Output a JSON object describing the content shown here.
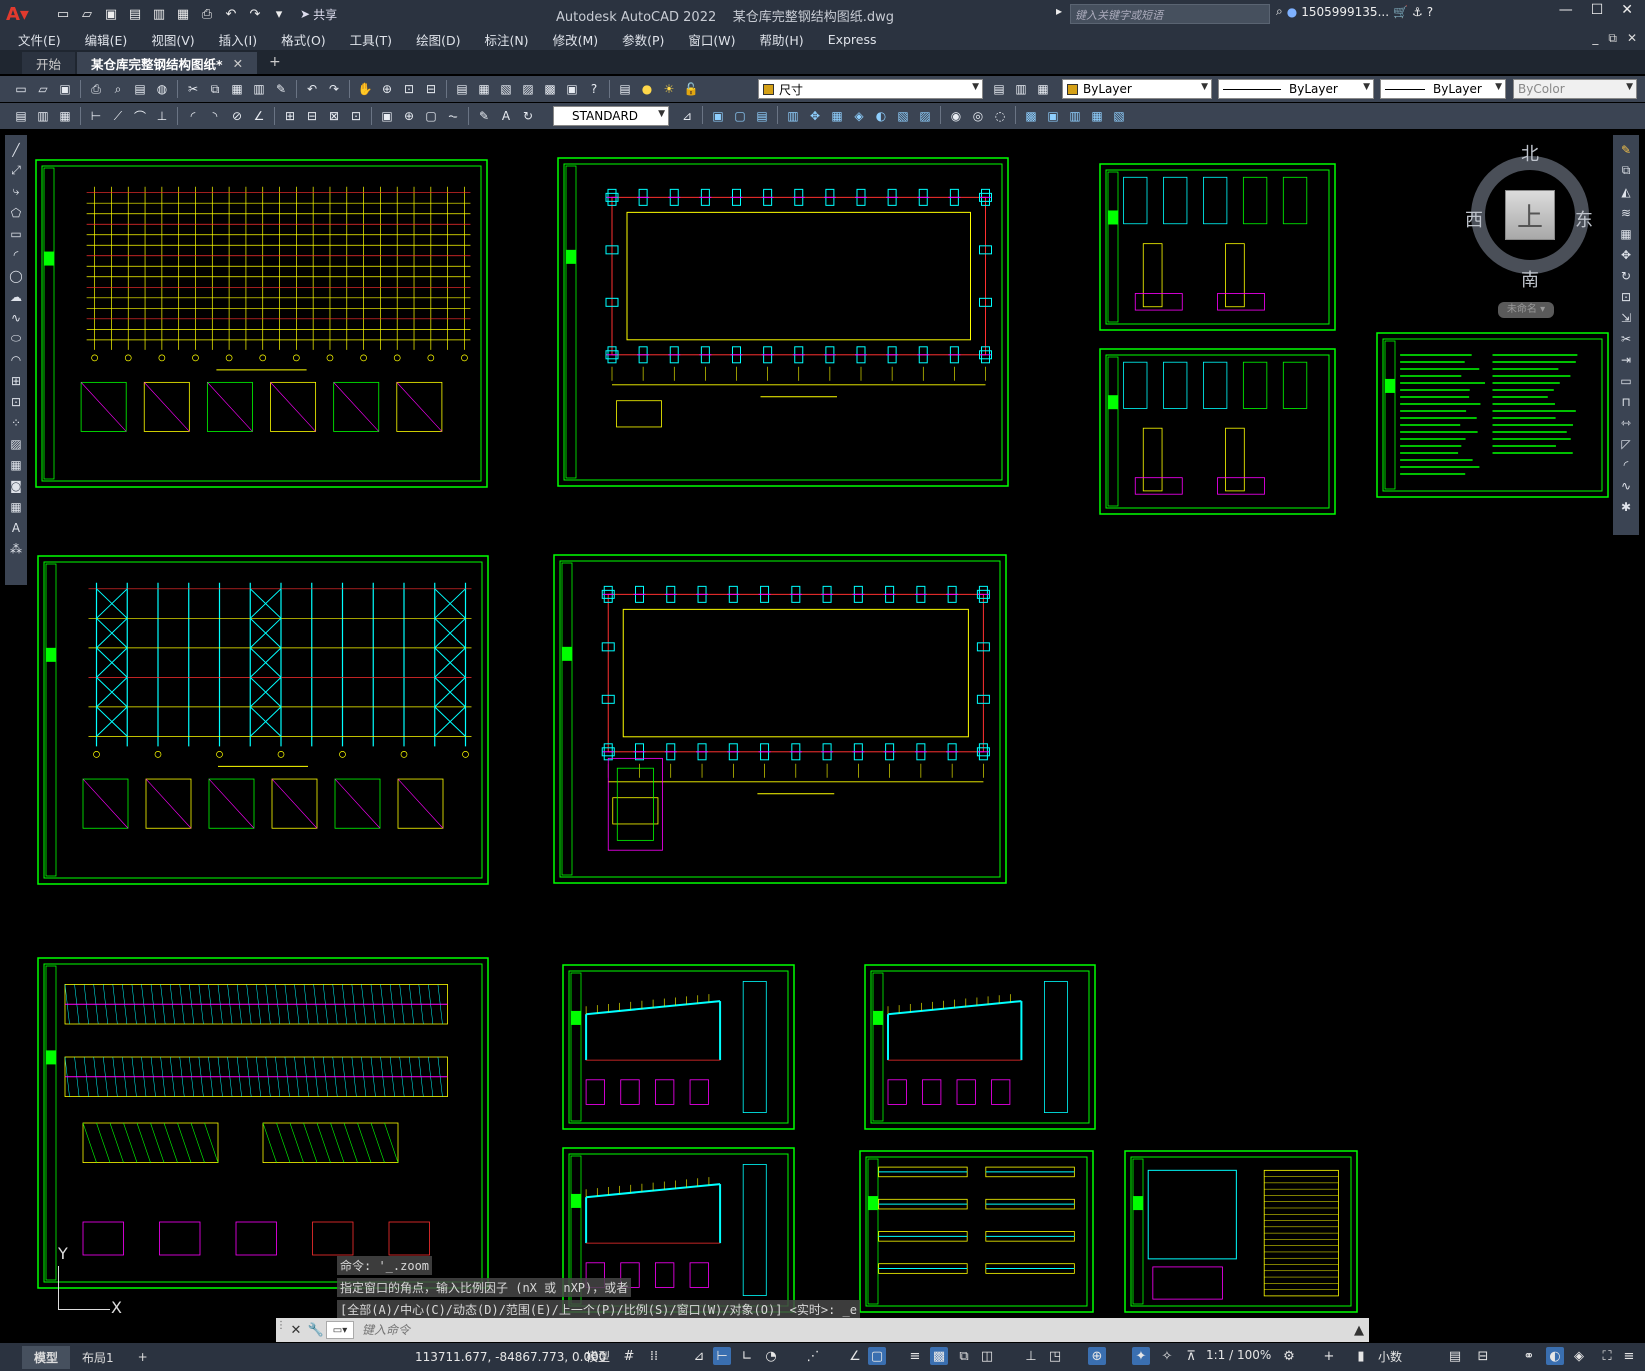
{
  "title_bar": {
    "app_name": "Autodesk AutoCAD 2022",
    "file_name": "某仓库完整钢结构图纸.dwg",
    "share_label": "共享",
    "search_placeholder": "键入关键字或短语",
    "user": "1505999135...",
    "help": "?"
  },
  "menu": [
    "文件(E)",
    "编辑(E)",
    "视图(V)",
    "插入(I)",
    "格式(O)",
    "工具(T)",
    "绘图(D)",
    "标注(N)",
    "修改(M)",
    "参数(P)",
    "窗口(W)",
    "帮助(H)",
    "Express"
  ],
  "tabs": [
    {
      "label": "开始",
      "active": false
    },
    {
      "label": "某仓库完整钢结构图纸*",
      "active": true
    }
  ],
  "toolbar": {
    "layer_name": "尺寸",
    "layer_color": "#d4a017",
    "color_value": "ByLayer",
    "linetype_value": "ByLayer",
    "lineweight_value": "ByLayer",
    "plotstyle_value": "ByColor",
    "text_style": "STANDARD"
  },
  "viewcube": {
    "north": "北",
    "south": "南",
    "east": "东",
    "west": "西",
    "face": "上",
    "wcs": "未命名"
  },
  "command": {
    "history": [
      "命令: '_.zoom",
      "指定窗口的角点，输入比例因子 (nX 或 nXP)，或者",
      "[全部(A)/中心(C)/动态(D)/范围(E)/上一个(P)/比例(S)/窗口(W)/对象(O)] <实时>: _e"
    ],
    "placeholder": "键入命令"
  },
  "layout_tabs": [
    "模型",
    "布局1"
  ],
  "status": {
    "coordinates": "113711.677, -84867.773, 0.000",
    "model_label": "模型",
    "scale": "1:1 / 100%",
    "units": "小数"
  },
  "ucs": {
    "x_label": "X",
    "y_label": "Y"
  },
  "colors": {
    "frame_green": "#00ff00",
    "bg": "#000000",
    "chrome": "#2b3340",
    "toolbar": "#3b4453",
    "accent_red": "#ff3030",
    "accent_cyan": "#00ffff",
    "accent_magenta": "#ff00ff",
    "accent_yellow": "#ffff00"
  }
}
